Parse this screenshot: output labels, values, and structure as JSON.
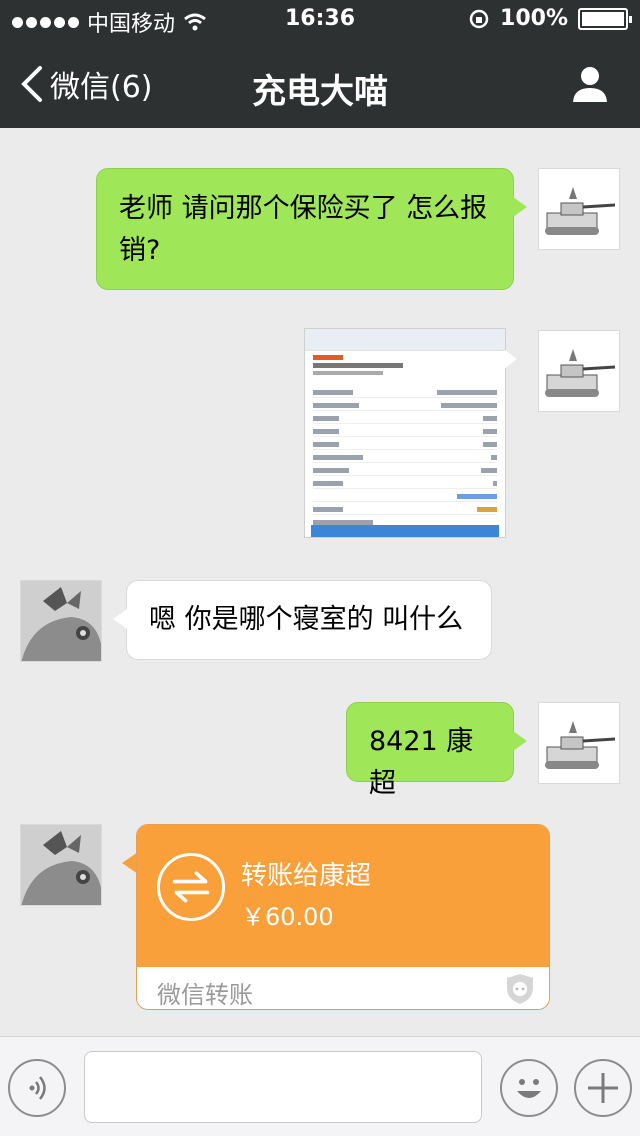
{
  "status_bar": {
    "carrier": "中国移动",
    "time": "16:36",
    "battery": "100%"
  },
  "nav": {
    "back_label": "微信(6)",
    "title": "充电大喵"
  },
  "messages": [
    {
      "from": "me",
      "type": "text",
      "text": "老师 请问那个保险买了 怎么报销?"
    },
    {
      "from": "me",
      "type": "image"
    },
    {
      "from": "other",
      "type": "text",
      "text": "嗯 你是哪个寝室的 叫什么"
    },
    {
      "from": "me",
      "type": "text",
      "text": "8421 康超"
    },
    {
      "from": "other",
      "type": "transfer",
      "title": "转账给康超",
      "amount": "￥60.00",
      "source": "微信转账"
    }
  ],
  "input": {
    "value": ""
  },
  "colors": {
    "nav_bg": "#2e3132",
    "chat_bg": "#ebebeb",
    "green_bubble": "#9fe658",
    "transfer_orange": "#f9a03a"
  },
  "icons": [
    "back-chevron-icon",
    "profile-icon",
    "voice-icon",
    "emoji-icon",
    "plus-icon",
    "transfer-arrows-icon",
    "shield-icon"
  ]
}
